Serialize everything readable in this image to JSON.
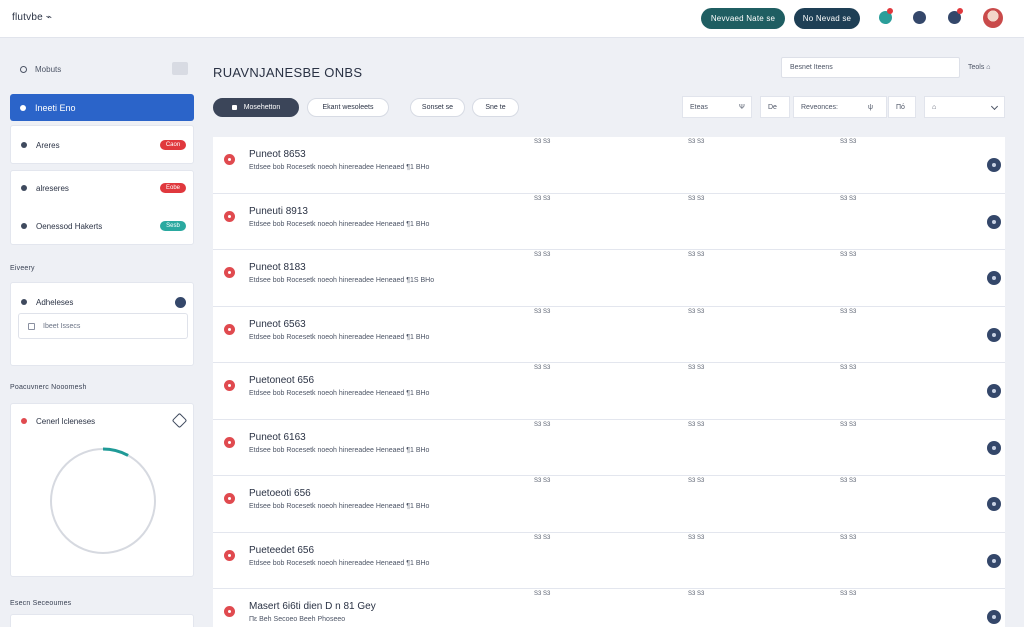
{
  "app": {
    "brand": "flutvbe ⌁"
  },
  "topbar": {
    "primary_button": "Nevvaed Nate se",
    "secondary_button": "No Nevad se",
    "icons": [
      "share-icon",
      "settings-icon",
      "notifications-icon"
    ],
    "accent_colors": {
      "teal": "#1f5e62",
      "navy": "#1e3f55",
      "alert": "#e0383d"
    }
  },
  "sidebar": {
    "search_label": "Mobuts",
    "active_item": "Ineeti Eno",
    "group1": [
      {
        "label": "Areres",
        "badge": "Caon"
      }
    ],
    "group2": [
      {
        "label": "alreseres",
        "badge": "Eobe"
      },
      {
        "label": "Oenessod Hakerts",
        "badge": "Sesb"
      }
    ],
    "section1_heading": "Eiveery",
    "section1_item": "Adheleses",
    "section1_input_placeholder": "Ibeet Issecs",
    "section2_heading": "Poacuvnerc Nooomesh",
    "donut_card_title": "Cenerl lcleneses",
    "section3_heading": "Esecn Seceoumes",
    "progress_fraction": 0.08
  },
  "main": {
    "title": "RUAVNJANESBE ONBS",
    "search_placeholder": "Besnet  Iteens",
    "tools_label": "Teols ⌂",
    "filters": [
      "Mosehetton",
      "Ekant wesoleets",
      "Sonset se",
      "Sne te"
    ],
    "selects": [
      {
        "value": "Eteas",
        "suffix": "Ψ"
      },
      {
        "value": "De",
        "suffix": ""
      },
      {
        "value": "Reveonces:",
        "suffix": "ψ"
      },
      {
        "value": "Πό",
        "suffix": ""
      },
      {
        "value": "⌂",
        "suffix": ""
      }
    ],
    "rows": [
      {
        "title": "Puneot 8653",
        "sub": "Etdsee  bob  Rocesetk noeoh  hinereadee  Heneaed  ¶1  BHo",
        "v1": "S3 S3",
        "v2": "S3 S3",
        "v3": "S3 S3"
      },
      {
        "title": "Puneuti 8913",
        "sub": "Etdsee  bob  Rocesetk noeoh  hinereadee  Heneaed  ¶1  BHo",
        "v1": "S3 S3",
        "v2": "S3 S3",
        "v3": "S3 S3"
      },
      {
        "title": "Puneot 8183",
        "sub": "Etdsee  bob  Rocesetk noeoh  hinereadee  Heneaed  ¶1S  BHo",
        "v1": "S3 S3",
        "v2": "S3 S3",
        "v3": "S3 S3"
      },
      {
        "title": "Puneot 6563",
        "sub": "Etdsee  bob  Rocesetk noeoh  hinereadee  Heneaed  ¶1  BHo",
        "v1": "S3 S3",
        "v2": "S3 S3",
        "v3": "S3 S3"
      },
      {
        "title": "Puetoneot 656",
        "sub": "Etdsee  bob  Rocesetk noeoh  hinereadee  Heneaed  ¶1  BHo",
        "v1": "S3 S3",
        "v2": "S3 S3",
        "v3": "S3 S3"
      },
      {
        "title": "Puneot 6163",
        "sub": "Etdsee  bob  Rocesetk noeoh  hinereadee  Heneaed  ¶1  BHo",
        "v1": "S3 S3",
        "v2": "S3 S3",
        "v3": "S3 S3"
      },
      {
        "title": "Puetoeoti 656",
        "sub": "Etdsee  bob  Rocesetk noeoh  hinereadee  Heneaed  ¶1  BHo",
        "v1": "S3 S3",
        "v2": "S3 S3",
        "v3": "S3 S3"
      },
      {
        "title": "Pueteedet 656",
        "sub": "Etdsee  bob  Rocesetk noeoh  hinereadee  Heneaed  ¶1  BHo",
        "v1": "S3 S3",
        "v2": "S3 S3",
        "v3": "S3 S3"
      },
      {
        "title": "Masert 6i6ti dien  D n  81  Gey",
        "sub": "Πε  Beh  Secoeo  Beeh   Phoseeo",
        "v1": "S3 S3",
        "v2": "S3 S3",
        "v3": "S3 S3"
      }
    ]
  }
}
